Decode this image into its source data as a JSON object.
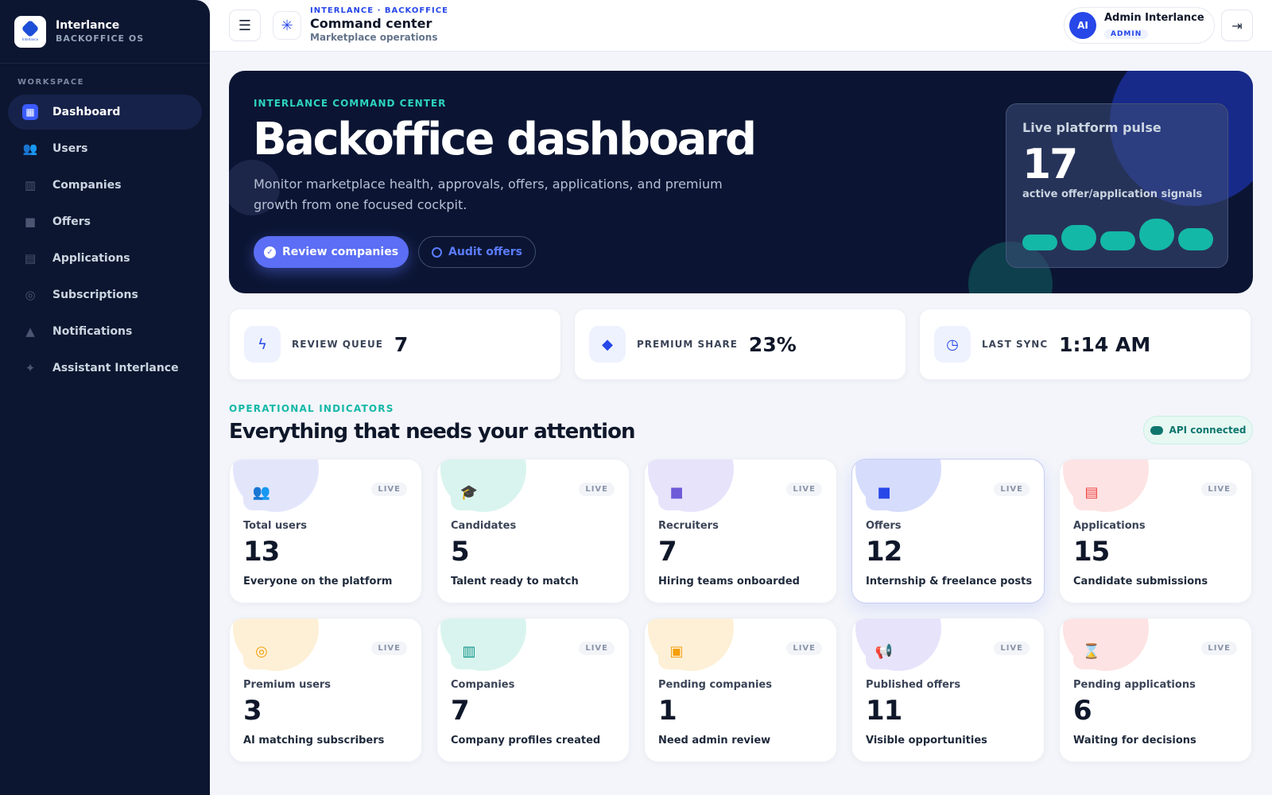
{
  "sidebar": {
    "brand_name": "Interlance",
    "brand_sub": "BACKOFFICE OS",
    "logo_text": "Interlance",
    "section_label": "WORKSPACE",
    "items": [
      {
        "label": "Dashboard",
        "icon": "dashboard-icon"
      },
      {
        "label": "Users",
        "icon": "users-icon"
      },
      {
        "label": "Companies",
        "icon": "building-icon"
      },
      {
        "label": "Offers",
        "icon": "briefcase-icon"
      },
      {
        "label": "Applications",
        "icon": "clipboard-icon"
      },
      {
        "label": "Subscriptions",
        "icon": "award-icon"
      },
      {
        "label": "Notifications",
        "icon": "bell-icon"
      },
      {
        "label": "Assistant Interlance",
        "icon": "sparkle-icon"
      }
    ]
  },
  "topbar": {
    "breadcrumb": "INTERLANCE · BACKOFFICE",
    "title": "Command center",
    "subtitle": "Marketplace operations",
    "user_initials": "AI",
    "user_name": "Admin Interlance",
    "user_role": "ADMIN"
  },
  "hero": {
    "kicker": "INTERLANCE COMMAND CENTER",
    "title": "Backoffice dashboard",
    "description": "Monitor marketplace health, approvals, offers, applications, and premium growth from one focused cockpit.",
    "primary_button": "Review companies",
    "secondary_button": "Audit offers",
    "pulse_title": "Live platform pulse",
    "pulse_value": "17",
    "pulse_subtitle": "active offer/application signals"
  },
  "stats": [
    {
      "label": "REVIEW QUEUE",
      "value": "7",
      "icon": "lightning-icon"
    },
    {
      "label": "PREMIUM SHARE",
      "value": "23%",
      "icon": "diamond-icon"
    },
    {
      "label": "LAST SYNC",
      "value": "1:14 AM",
      "icon": "clock-icon"
    }
  ],
  "section": {
    "kicker": "OPERATIONAL INDICATORS",
    "title": "Everything that needs your attention",
    "api_status": "API connected"
  },
  "cards": [
    {
      "label": "Total users",
      "value": "13",
      "desc": "Everyone on the platform",
      "badge": "LIVE",
      "icon": "users-icon",
      "color": "#4f5bd5",
      "tint": "#e3e6fb"
    },
    {
      "label": "Candidates",
      "value": "5",
      "desc": "Talent ready to match",
      "badge": "LIVE",
      "icon": "graduation-cap-icon",
      "color": "#0d9488",
      "tint": "#d9f4ee"
    },
    {
      "label": "Recruiters",
      "value": "7",
      "desc": "Hiring teams onboarded",
      "badge": "LIVE",
      "icon": "briefcase-icon",
      "color": "#6d5bd8",
      "tint": "#e7e3fb"
    },
    {
      "label": "Offers",
      "value": "12",
      "desc": "Internship & freelance posts",
      "badge": "LIVE",
      "icon": "briefcase-icon",
      "color": "#2747e8",
      "tint": "#d6dcfb"
    },
    {
      "label": "Applications",
      "value": "15",
      "desc": "Candidate submissions",
      "badge": "LIVE",
      "icon": "clipboard-icon",
      "color": "#ef4444",
      "tint": "#fde3e3"
    },
    {
      "label": "Premium users",
      "value": "3",
      "desc": "AI matching subscribers",
      "badge": "LIVE",
      "icon": "award-icon",
      "color": "#f59e0b",
      "tint": "#fdf0d6"
    },
    {
      "label": "Companies",
      "value": "7",
      "desc": "Company profiles created",
      "badge": "LIVE",
      "icon": "building-icon",
      "color": "#0d9488",
      "tint": "#d9f4ee"
    },
    {
      "label": "Pending companies",
      "value": "1",
      "desc": "Need admin review",
      "badge": "LIVE",
      "icon": "pending-clipboard-icon",
      "color": "#f59e0b",
      "tint": "#fdf0d6"
    },
    {
      "label": "Published offers",
      "value": "11",
      "desc": "Visible opportunities",
      "badge": "LIVE",
      "icon": "megaphone-icon",
      "color": "#6d5bd8",
      "tint": "#e7e3fb"
    },
    {
      "label": "Pending applications",
      "value": "6",
      "desc": "Waiting for decisions",
      "badge": "LIVE",
      "icon": "hourglass-icon",
      "color": "#ef4444",
      "tint": "#fde3e3"
    }
  ]
}
